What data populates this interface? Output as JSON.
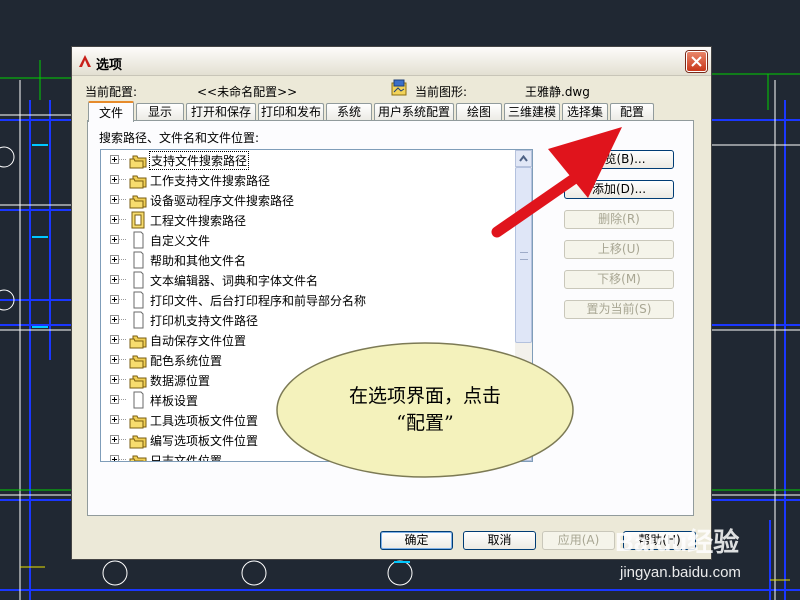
{
  "dialog": {
    "title": "选项",
    "current_config_label": "当前配置:",
    "current_config_value": "<<未命名配置>>",
    "current_drawing_label": "当前图形:",
    "current_drawing_value": "王雅静.dwg"
  },
  "tabs": [
    {
      "label": "文件",
      "active": true
    },
    {
      "label": "显示"
    },
    {
      "label": "打开和保存"
    },
    {
      "label": "打印和发布"
    },
    {
      "label": "系统"
    },
    {
      "label": "用户系统配置"
    },
    {
      "label": "绘图"
    },
    {
      "label": "三维建模"
    },
    {
      "label": "选择集"
    },
    {
      "label": "配置"
    }
  ],
  "panel": {
    "caption": "搜索路径、文件名和文件位置:",
    "tree_items": [
      {
        "label": "支持文件搜索路径",
        "icon": "folder-stack-icon",
        "selected": true
      },
      {
        "label": "工作支持文件搜索路径",
        "icon": "folder-stack-icon"
      },
      {
        "label": "设备驱动程序文件搜索路径",
        "icon": "folder-stack-icon"
      },
      {
        "label": "工程文件搜索路径",
        "icon": "project-files-icon"
      },
      {
        "label": "自定义文件",
        "icon": "document-icon"
      },
      {
        "label": "帮助和其他文件名",
        "icon": "document-icon"
      },
      {
        "label": "文本编辑器、词典和字体文件名",
        "icon": "document-icon"
      },
      {
        "label": "打印文件、后台打印程序和前导部分名称",
        "icon": "document-icon"
      },
      {
        "label": "打印机支持文件路径",
        "icon": "document-icon"
      },
      {
        "label": "自动保存文件位置",
        "icon": "folder-stack-icon"
      },
      {
        "label": "配色系统位置",
        "icon": "folder-stack-icon"
      },
      {
        "label": "数据源位置",
        "icon": "folder-stack-icon"
      },
      {
        "label": "样板设置",
        "icon": "document-icon"
      },
      {
        "label": "工具选项板文件位置",
        "icon": "folder-stack-icon"
      },
      {
        "label": "编写选项板文件位置",
        "icon": "folder-stack-icon"
      },
      {
        "label": "日志文件位置",
        "icon": "folder-stack-icon"
      }
    ],
    "buttons": {
      "browse": "浏览(B)...",
      "add": "添加(D)...",
      "remove": "删除(R)",
      "move_up": "上移(U)",
      "move_down": "下移(M)",
      "set_current": "置为当前(S)"
    }
  },
  "footer": {
    "ok": "确定",
    "cancel": "取消",
    "apply": "应用(A)",
    "help": "帮助(H)"
  },
  "callout": {
    "line1": "在选项界面，点击",
    "line2": "“配置”"
  },
  "watermark": {
    "logo": "Baidu经验",
    "url": "jingyan.baidu.com"
  },
  "colors": {
    "cad_background": "#202833",
    "active_tab_accent": "#e68b2c",
    "arrow": "#e0141c",
    "callout_fill": "#f4f2bc",
    "close_button": "#c9371a"
  }
}
